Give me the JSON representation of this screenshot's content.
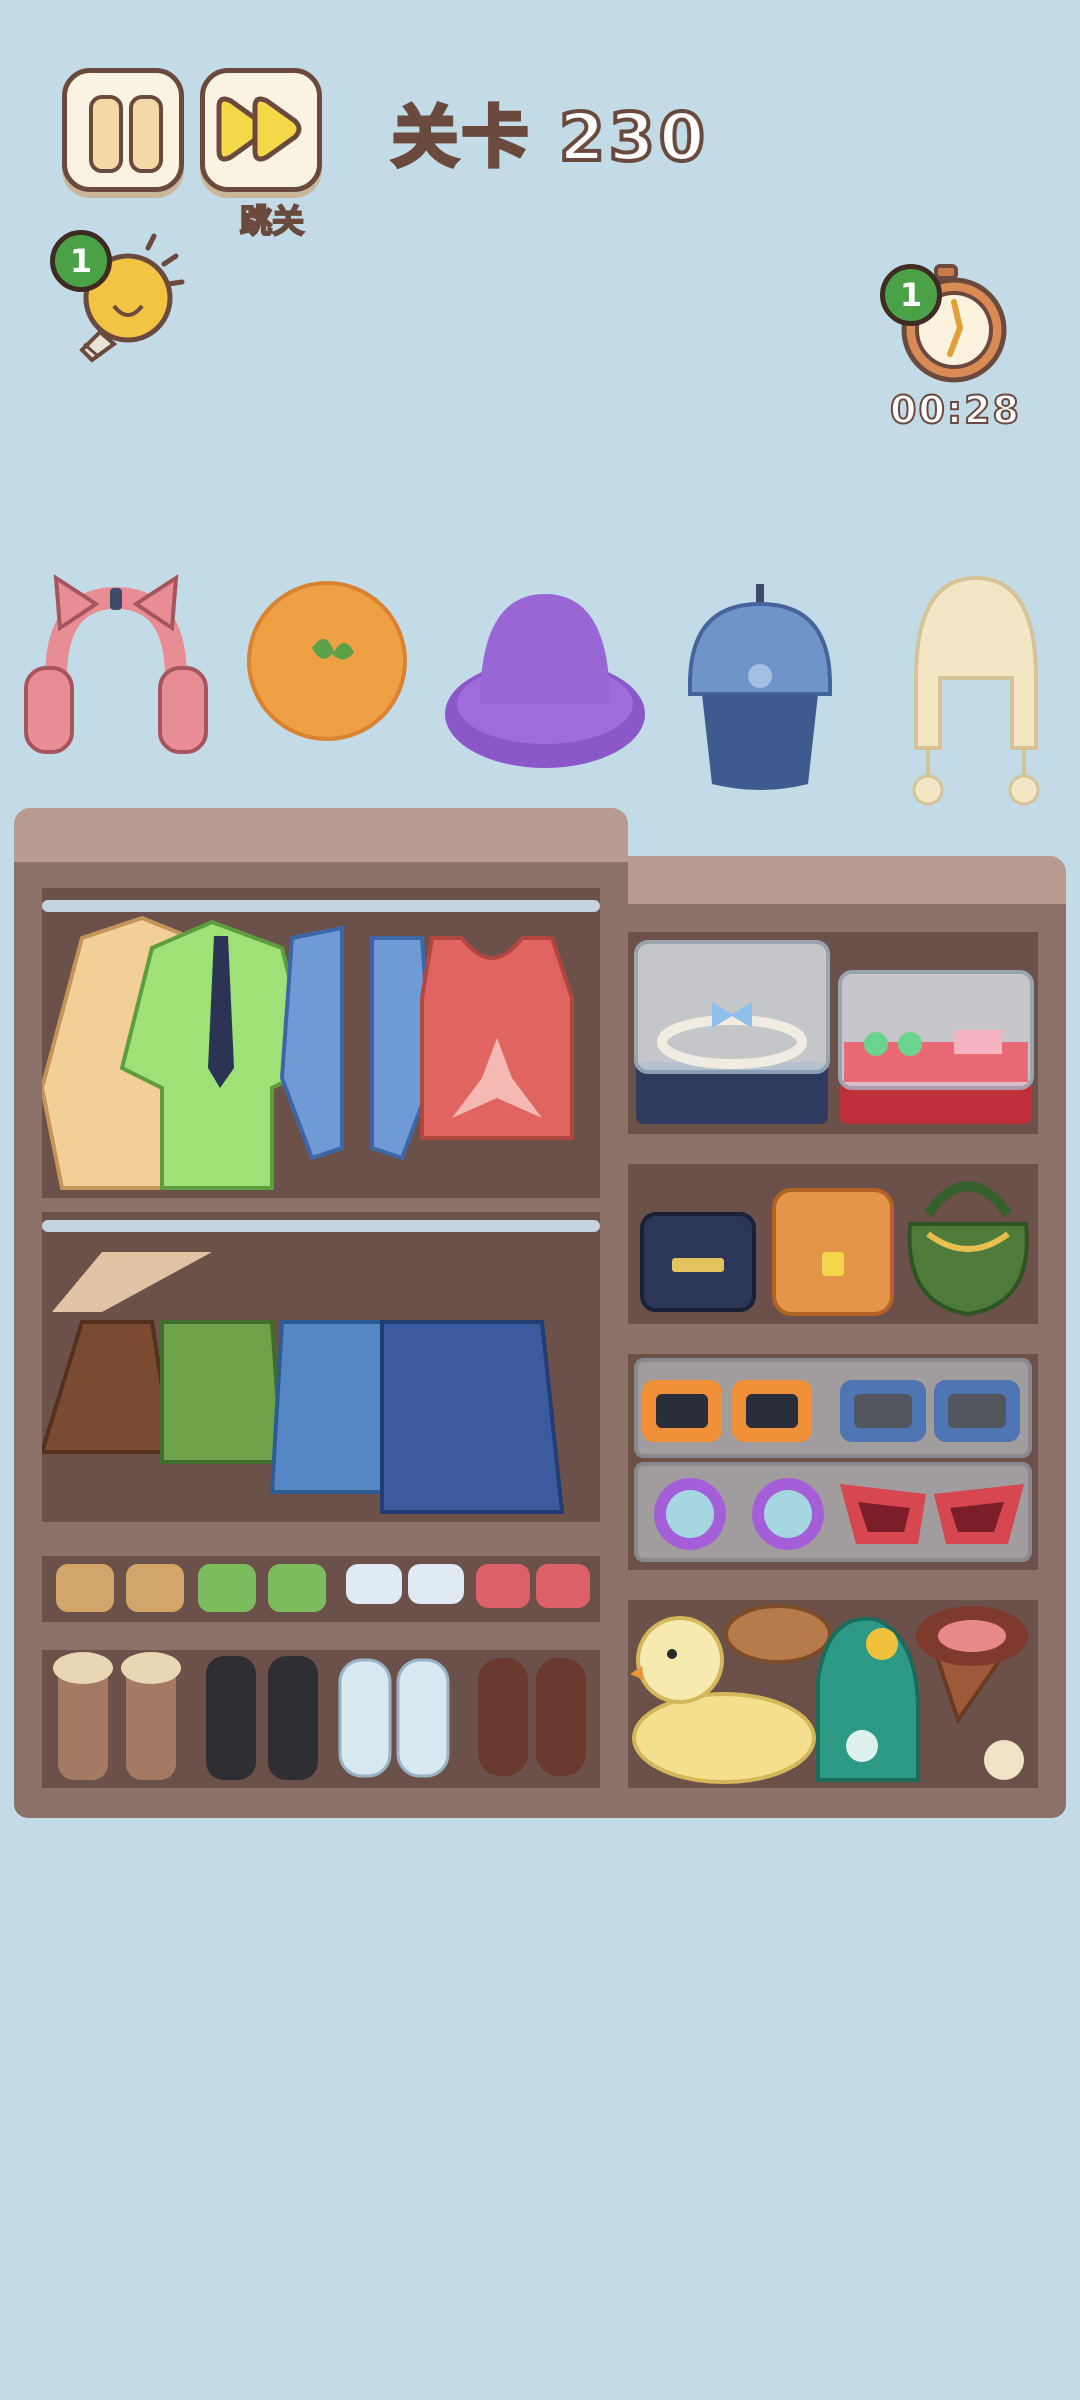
{
  "toolbar": {
    "pause_icon": "pause-icon",
    "skip_icon": "fast-forward-icon",
    "skip_label": "跳关"
  },
  "level": {
    "label": "关卡 230"
  },
  "hint": {
    "icon": "lightbulb-icon",
    "count": "1"
  },
  "timer": {
    "icon": "stopwatch-icon",
    "count": "1",
    "time": "00:28"
  },
  "targets": [
    {
      "name": "cat-ear-headphones",
      "color": "#e98d95"
    },
    {
      "name": "orange-beret",
      "color": "#f0a044"
    },
    {
      "name": "purple-bucket-hat",
      "color": "#9966d6"
    },
    {
      "name": "blue-cap",
      "color": "#6e94c8"
    },
    {
      "name": "fluffy-earflap-hat",
      "color": "#f3e6c4"
    }
  ],
  "wardrobe": {
    "top_rack": [
      "cream-sweater",
      "green-shirt-with-tie",
      "blue-vest",
      "red-tank-top"
    ],
    "bottom_rack": [
      "brown-pleated-skirt",
      "green-cargo-shorts",
      "blue-denim-shorts",
      "navy-shorts"
    ],
    "socks": [
      "tan-socks",
      "green-socks",
      "white-socks",
      "red-socks"
    ],
    "shoes": [
      "fur-boots",
      "black-boots",
      "white-sneakers",
      "brown-oxfords"
    ],
    "right_shelves": [
      [
        "jewelry-box-pearl",
        "jewelry-box-red"
      ],
      [
        "navy-wallet",
        "orange-backpack",
        "green-handbag"
      ],
      [
        "orange-sunglasses",
        "blue-sunglasses",
        "purple-round-glasses",
        "red-cat-eye-glasses"
      ],
      [
        "duck-float",
        "bread",
        "green-plush",
        "ice-cream-cone"
      ]
    ]
  }
}
